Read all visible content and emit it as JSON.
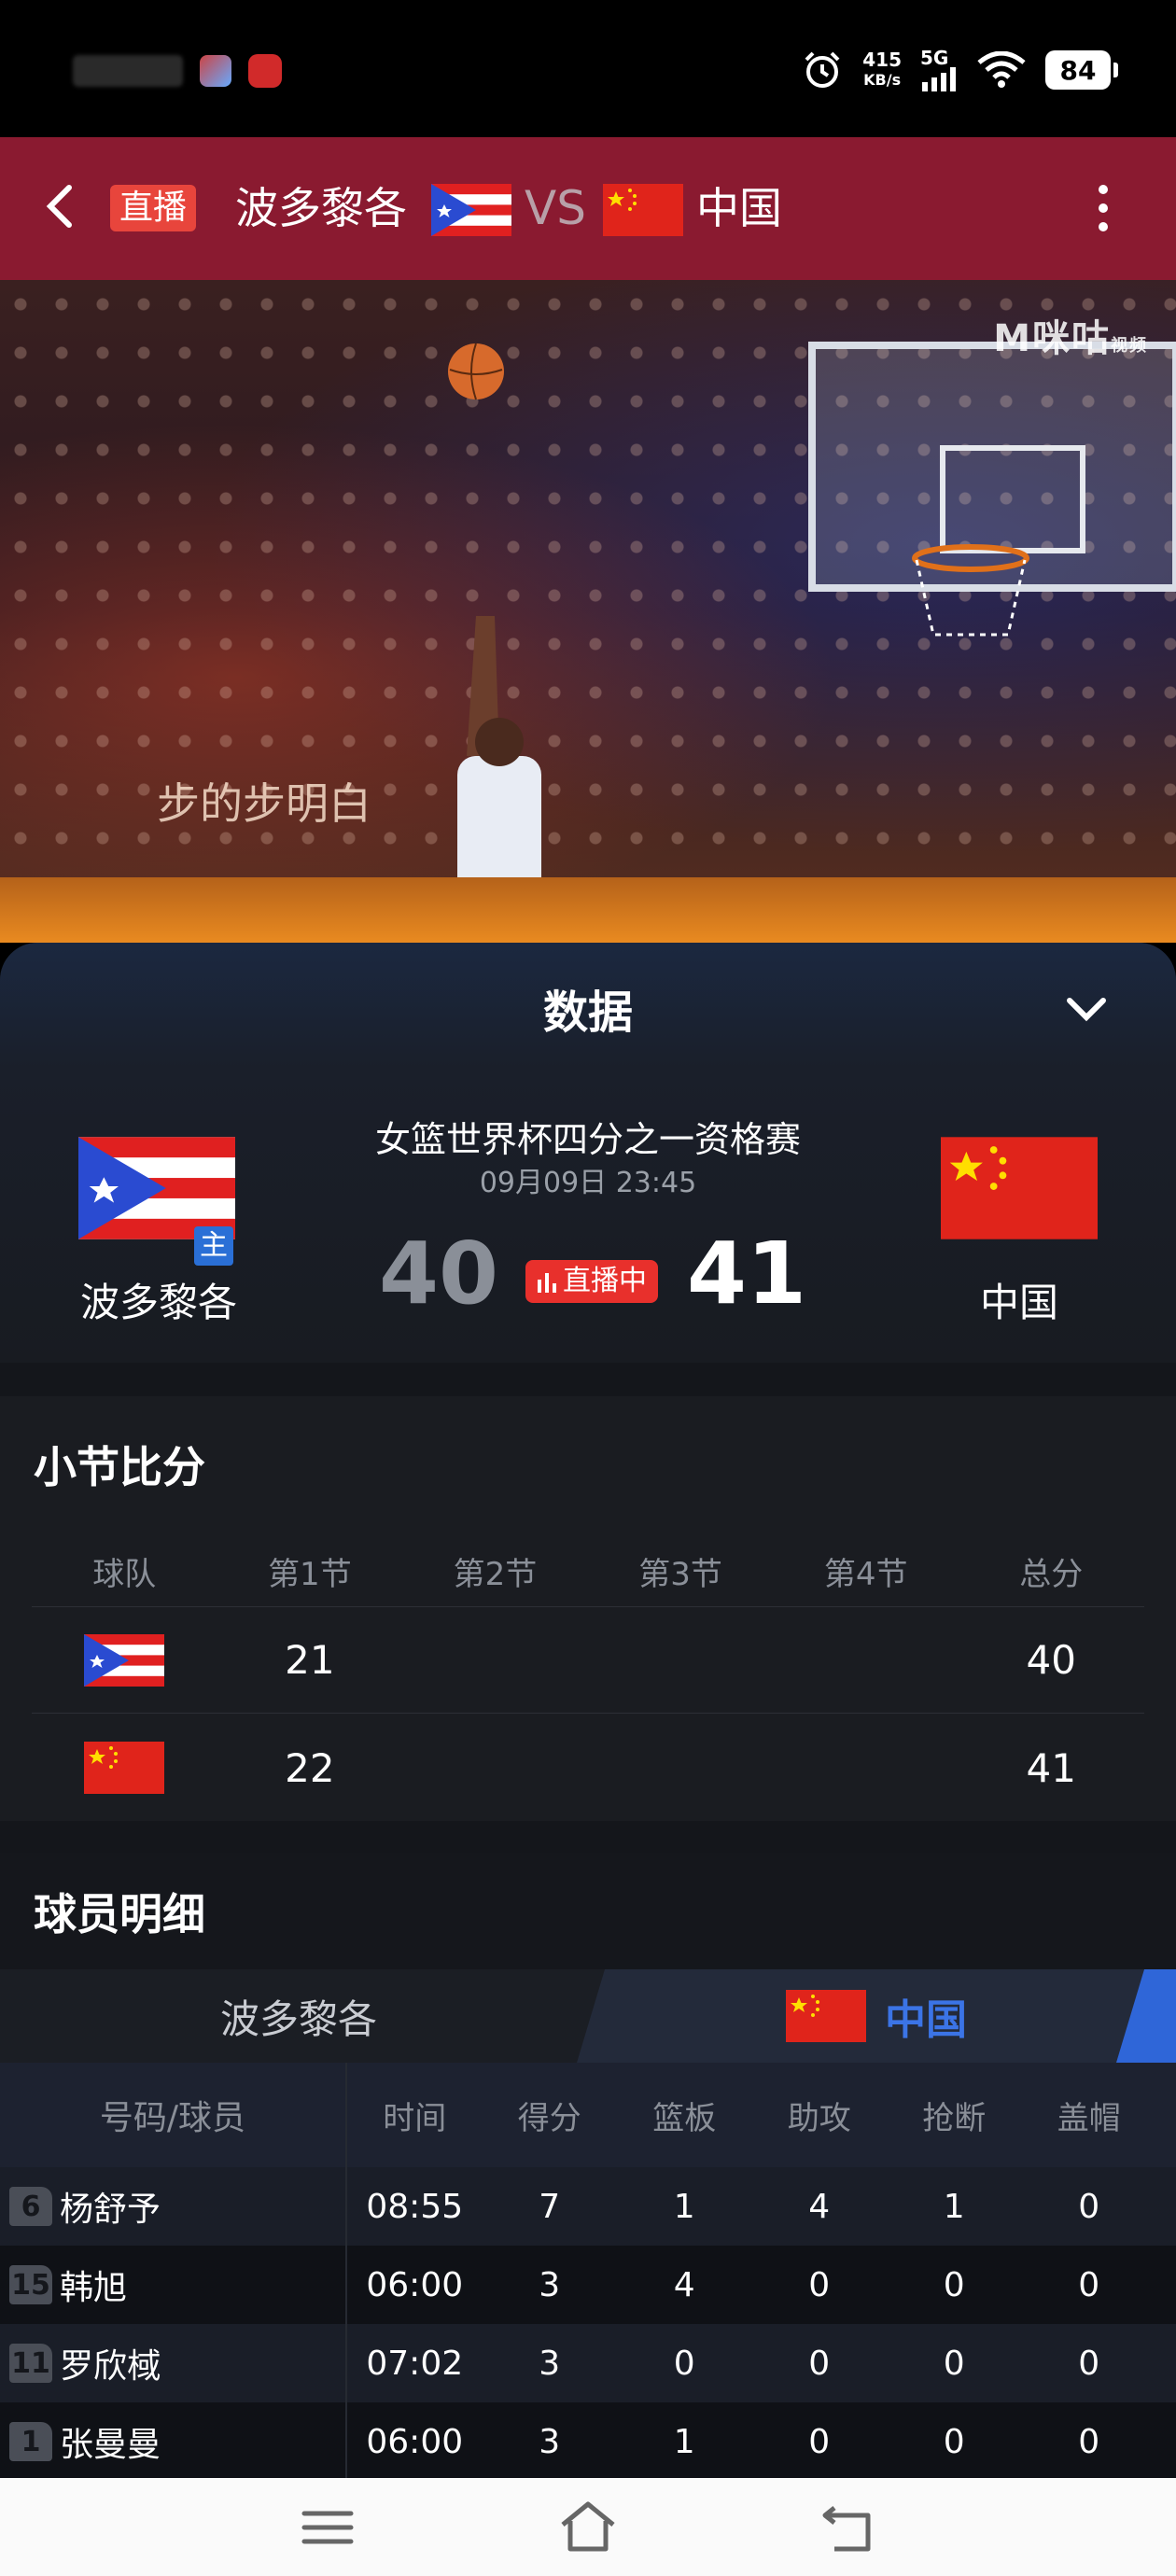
{
  "status_bar": {
    "speed_value": "415",
    "speed_unit": "KB/s",
    "network": "5G",
    "battery": "84"
  },
  "header": {
    "live_tag": "直播",
    "home_team": "波多黎各",
    "vs": "VS",
    "away_team": "中国"
  },
  "video": {
    "watermark": "M咪咕",
    "watermark_small": "视频",
    "subtitle": "步的步明白"
  },
  "panel": {
    "title": "数据",
    "match_name": "女篮世界杯四分之一资格赛",
    "match_time": "09月09日 23:45",
    "home_team": "波多黎各",
    "home_badge": "主",
    "away_team": "中国",
    "home_score": "40",
    "away_score": "41",
    "live_label": "直播中"
  },
  "quarters": {
    "title": "小节比分",
    "headers": [
      "球队",
      "第1节",
      "第2节",
      "第3节",
      "第4节",
      "总分"
    ],
    "rows": [
      {
        "team_flag": "puerto-rico-flag",
        "q1": "21",
        "q2": "",
        "q3": "",
        "q4": "",
        "total": "40"
      },
      {
        "team_flag": "china-flag",
        "q1": "22",
        "q2": "",
        "q3": "",
        "q4": "",
        "total": "41"
      }
    ]
  },
  "players": {
    "title": "球员明细",
    "tab_home": "波多黎各",
    "tab_away": "中国",
    "headers": [
      "号码/球员",
      "时间",
      "得分",
      "篮板",
      "助攻",
      "抢断",
      "盖帽"
    ],
    "rows": [
      {
        "number": "6",
        "name": "杨舒予",
        "time": "08:55",
        "pts": "7",
        "reb": "1",
        "ast": "4",
        "stl": "1",
        "blk": "0"
      },
      {
        "number": "15",
        "name": "韩旭",
        "time": "06:00",
        "pts": "3",
        "reb": "4",
        "ast": "0",
        "stl": "0",
        "blk": "0"
      },
      {
        "number": "11",
        "name": "罗欣棫",
        "time": "07:02",
        "pts": "3",
        "reb": "0",
        "ast": "0",
        "stl": "0",
        "blk": "0"
      },
      {
        "number": "1",
        "name": "张曼曼",
        "time": "06:00",
        "pts": "3",
        "reb": "1",
        "ast": "0",
        "stl": "0",
        "blk": "0"
      }
    ]
  },
  "colors": {
    "header_bg": "#8a1a30",
    "live_red": "#e8302c",
    "accent_blue": "#3b74e6"
  }
}
